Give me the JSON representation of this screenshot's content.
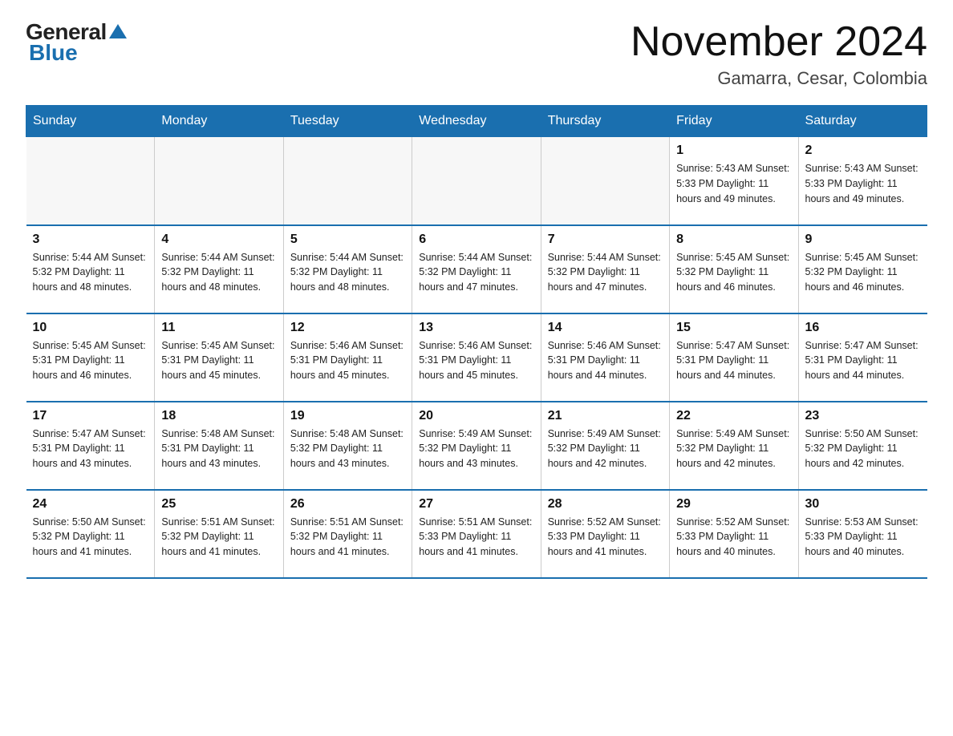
{
  "logo": {
    "general": "General",
    "blue": "Blue"
  },
  "header": {
    "title": "November 2024",
    "location": "Gamarra, Cesar, Colombia"
  },
  "days_of_week": [
    "Sunday",
    "Monday",
    "Tuesday",
    "Wednesday",
    "Thursday",
    "Friday",
    "Saturday"
  ],
  "weeks": [
    [
      {
        "day": "",
        "info": ""
      },
      {
        "day": "",
        "info": ""
      },
      {
        "day": "",
        "info": ""
      },
      {
        "day": "",
        "info": ""
      },
      {
        "day": "",
        "info": ""
      },
      {
        "day": "1",
        "info": "Sunrise: 5:43 AM\nSunset: 5:33 PM\nDaylight: 11 hours\nand 49 minutes."
      },
      {
        "day": "2",
        "info": "Sunrise: 5:43 AM\nSunset: 5:33 PM\nDaylight: 11 hours\nand 49 minutes."
      }
    ],
    [
      {
        "day": "3",
        "info": "Sunrise: 5:44 AM\nSunset: 5:32 PM\nDaylight: 11 hours\nand 48 minutes."
      },
      {
        "day": "4",
        "info": "Sunrise: 5:44 AM\nSunset: 5:32 PM\nDaylight: 11 hours\nand 48 minutes."
      },
      {
        "day": "5",
        "info": "Sunrise: 5:44 AM\nSunset: 5:32 PM\nDaylight: 11 hours\nand 48 minutes."
      },
      {
        "day": "6",
        "info": "Sunrise: 5:44 AM\nSunset: 5:32 PM\nDaylight: 11 hours\nand 47 minutes."
      },
      {
        "day": "7",
        "info": "Sunrise: 5:44 AM\nSunset: 5:32 PM\nDaylight: 11 hours\nand 47 minutes."
      },
      {
        "day": "8",
        "info": "Sunrise: 5:45 AM\nSunset: 5:32 PM\nDaylight: 11 hours\nand 46 minutes."
      },
      {
        "day": "9",
        "info": "Sunrise: 5:45 AM\nSunset: 5:32 PM\nDaylight: 11 hours\nand 46 minutes."
      }
    ],
    [
      {
        "day": "10",
        "info": "Sunrise: 5:45 AM\nSunset: 5:31 PM\nDaylight: 11 hours\nand 46 minutes."
      },
      {
        "day": "11",
        "info": "Sunrise: 5:45 AM\nSunset: 5:31 PM\nDaylight: 11 hours\nand 45 minutes."
      },
      {
        "day": "12",
        "info": "Sunrise: 5:46 AM\nSunset: 5:31 PM\nDaylight: 11 hours\nand 45 minutes."
      },
      {
        "day": "13",
        "info": "Sunrise: 5:46 AM\nSunset: 5:31 PM\nDaylight: 11 hours\nand 45 minutes."
      },
      {
        "day": "14",
        "info": "Sunrise: 5:46 AM\nSunset: 5:31 PM\nDaylight: 11 hours\nand 44 minutes."
      },
      {
        "day": "15",
        "info": "Sunrise: 5:47 AM\nSunset: 5:31 PM\nDaylight: 11 hours\nand 44 minutes."
      },
      {
        "day": "16",
        "info": "Sunrise: 5:47 AM\nSunset: 5:31 PM\nDaylight: 11 hours\nand 44 minutes."
      }
    ],
    [
      {
        "day": "17",
        "info": "Sunrise: 5:47 AM\nSunset: 5:31 PM\nDaylight: 11 hours\nand 43 minutes."
      },
      {
        "day": "18",
        "info": "Sunrise: 5:48 AM\nSunset: 5:31 PM\nDaylight: 11 hours\nand 43 minutes."
      },
      {
        "day": "19",
        "info": "Sunrise: 5:48 AM\nSunset: 5:32 PM\nDaylight: 11 hours\nand 43 minutes."
      },
      {
        "day": "20",
        "info": "Sunrise: 5:49 AM\nSunset: 5:32 PM\nDaylight: 11 hours\nand 43 minutes."
      },
      {
        "day": "21",
        "info": "Sunrise: 5:49 AM\nSunset: 5:32 PM\nDaylight: 11 hours\nand 42 minutes."
      },
      {
        "day": "22",
        "info": "Sunrise: 5:49 AM\nSunset: 5:32 PM\nDaylight: 11 hours\nand 42 minutes."
      },
      {
        "day": "23",
        "info": "Sunrise: 5:50 AM\nSunset: 5:32 PM\nDaylight: 11 hours\nand 42 minutes."
      }
    ],
    [
      {
        "day": "24",
        "info": "Sunrise: 5:50 AM\nSunset: 5:32 PM\nDaylight: 11 hours\nand 41 minutes."
      },
      {
        "day": "25",
        "info": "Sunrise: 5:51 AM\nSunset: 5:32 PM\nDaylight: 11 hours\nand 41 minutes."
      },
      {
        "day": "26",
        "info": "Sunrise: 5:51 AM\nSunset: 5:32 PM\nDaylight: 11 hours\nand 41 minutes."
      },
      {
        "day": "27",
        "info": "Sunrise: 5:51 AM\nSunset: 5:33 PM\nDaylight: 11 hours\nand 41 minutes."
      },
      {
        "day": "28",
        "info": "Sunrise: 5:52 AM\nSunset: 5:33 PM\nDaylight: 11 hours\nand 41 minutes."
      },
      {
        "day": "29",
        "info": "Sunrise: 5:52 AM\nSunset: 5:33 PM\nDaylight: 11 hours\nand 40 minutes."
      },
      {
        "day": "30",
        "info": "Sunrise: 5:53 AM\nSunset: 5:33 PM\nDaylight: 11 hours\nand 40 minutes."
      }
    ]
  ]
}
